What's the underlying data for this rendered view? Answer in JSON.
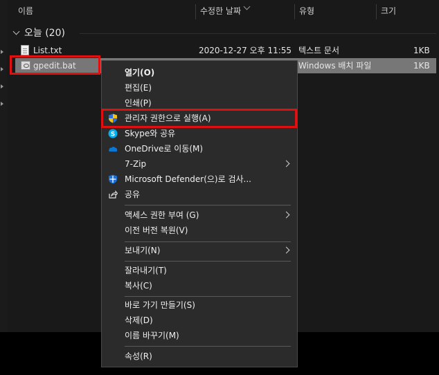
{
  "columns": {
    "name": "이름",
    "modified": "수정한 날짜",
    "type": "유형",
    "size": "크기"
  },
  "group": {
    "label": "오늘 (20)"
  },
  "files": [
    {
      "name": "List.txt",
      "modified": "2020-12-27 오후 11:55",
      "type": "텍스트 문서",
      "size": "1KB"
    },
    {
      "name": "gpedit.bat",
      "modified": "",
      "type": "Windows 배치 파일",
      "size": "1KB"
    }
  ],
  "context_menu": {
    "items": [
      {
        "label": "열기(O)"
      },
      {
        "label": "편집(E)"
      },
      {
        "label": "인쇄(P)"
      },
      {
        "label": "관리자 권한으로 실행(A)"
      },
      {
        "label": "Skype와 공유"
      },
      {
        "label": "OneDrive로 이동(M)"
      },
      {
        "label": "7-Zip"
      },
      {
        "label": "Microsoft Defender(으)로 검사..."
      },
      {
        "label": "공유"
      },
      {
        "label": "액세스 권한 부여 (G)"
      },
      {
        "label": "이전 버전 복원(V)"
      },
      {
        "label": "보내기(N)"
      },
      {
        "label": "잘라내기(T)"
      },
      {
        "label": "복사(C)"
      },
      {
        "label": "바로 가기 만들기(S)"
      },
      {
        "label": "삭제(D)"
      },
      {
        "label": "이름 바꾸기(M)"
      },
      {
        "label": "속성(R)"
      }
    ]
  },
  "icons": {
    "skype": "skype-icon",
    "onedrive": "onedrive-icon",
    "defender": "shield-icon",
    "share": "share-icon",
    "uac": "uac-shield-icon"
  },
  "colors": {
    "highlight": "#e01010",
    "selection": "#777777",
    "menu_bg": "#2b2b2b",
    "skype": "#00aff0",
    "onedrive": "#0a78d4",
    "defender": "#1b6fd8"
  }
}
